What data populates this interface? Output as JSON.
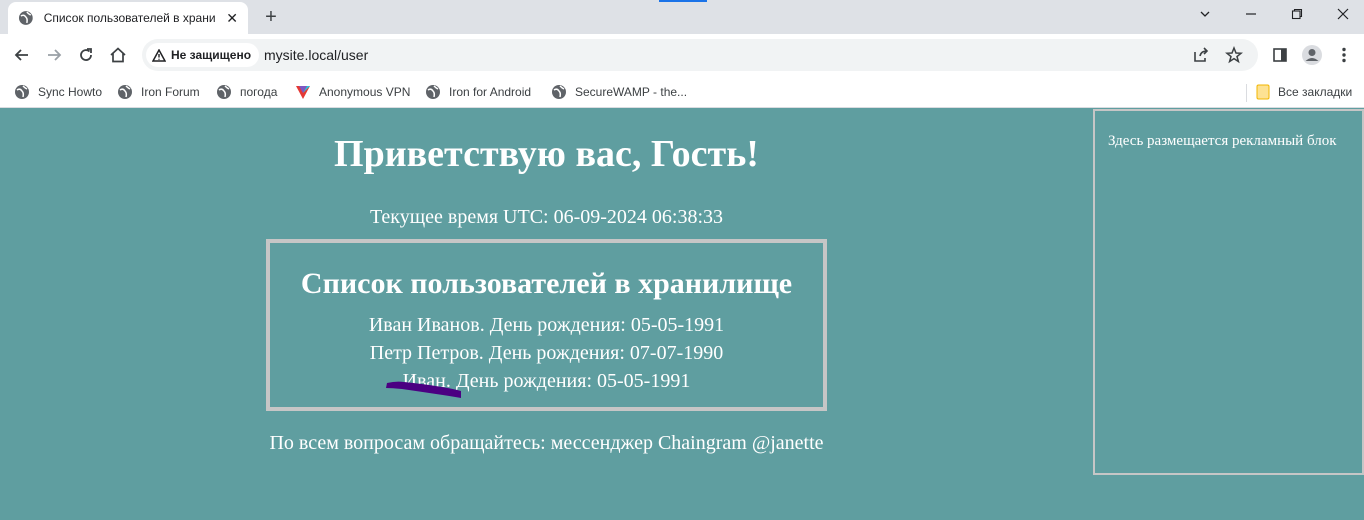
{
  "browser": {
    "tab": {
      "title": "Список пользователей в храни",
      "favicon": "globe-icon"
    },
    "window_controls": [
      "chevron-down-icon",
      "minimize-icon",
      "restore-icon",
      "close-icon"
    ],
    "address_bar": {
      "security_label": "Не защищено",
      "url": "mysite.local/user"
    },
    "bookmarks": [
      {
        "label": "Sync Howto",
        "icon": "globe-icon"
      },
      {
        "label": "Iron Forum",
        "icon": "globe-icon"
      },
      {
        "label": "погода",
        "icon": "globe-icon"
      },
      {
        "label": "Anonymous VPN",
        "icon": "vpn-icon"
      },
      {
        "label": "Iron for Android",
        "icon": "globe-icon"
      },
      {
        "label": "SecureWAMP - the...",
        "icon": "globe-icon"
      }
    ],
    "all_bookmarks_label": "Все закладки",
    "accent_color": "#1a73e8"
  },
  "page": {
    "background_color": "#5f9ea0",
    "greeting": "Приветствую вас, Гость!",
    "time_line": "Текущее время UTC: 06-09-2024 06:38:33",
    "user_box": {
      "title": "Список пользователей в хранилище",
      "users": [
        "Иван Иванов. День рождения: 05-05-1991",
        "Петр Петров. День рождения: 07-07-1990",
        "Иван. День рождения: 05-05-1991"
      ],
      "scribble_color": "#4b0082"
    },
    "footer": "По всем вопросам обращайтесь: мессенджер Chaingram @janette",
    "ad_block": {
      "text": "Здесь размещается рекламный блок"
    }
  }
}
